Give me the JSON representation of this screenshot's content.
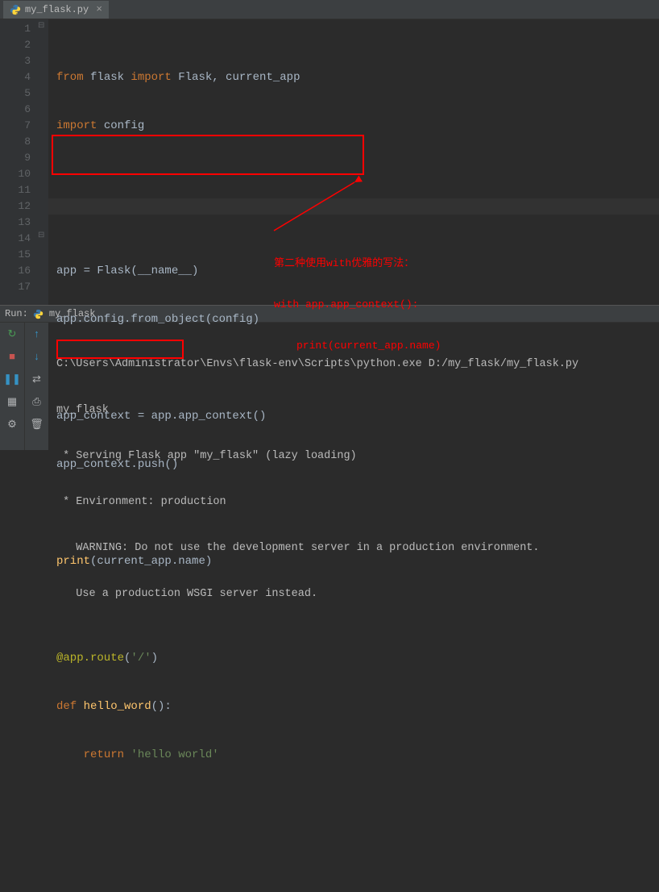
{
  "tab": {
    "filename": "my_flask.py"
  },
  "gutter": [
    "1",
    "2",
    "3",
    "4",
    "5",
    "6",
    "7",
    "8",
    "9",
    "10",
    "11",
    "12",
    "13",
    "14",
    "15",
    "16",
    "17"
  ],
  "code": {
    "l1_from": "from",
    "l1_mod": " flask ",
    "l1_import": "import",
    "l1_names": " Flask, current_app",
    "l2_import": "import",
    "l2_mod": " config",
    "l5": "app = Flask(__name__)",
    "l6": "app.config.from_object(config)",
    "l8": "app_context = app.app_context()",
    "l9": "app_context.push()",
    "l11_print": "print",
    "l11_rest": "(current_app.name)",
    "l13_deco": "@app.route",
    "l13_arg": "(",
    "l13_str": "'/'",
    "l13_close": ")",
    "l14_def": "def ",
    "l14_name": "hello_word",
    "l14_rest": "():",
    "l15_kw": "return ",
    "l15_str": "'hello world'"
  },
  "annotation": {
    "line1": "第二种使用with优雅的写法：",
    "line2": "with app.app_context():",
    "line3": "print(current_app.name)"
  },
  "run": {
    "title_prefix": "Run:",
    "config_name": "my_flask",
    "out1": "C:\\Users\\Administrator\\Envs\\flask-env\\Scripts\\python.exe D:/my_flask/my_flask.py",
    "out2": "my_flask",
    "out3": " * Serving Flask app \"my_flask\" (lazy loading)",
    "out4": " * Environment: production",
    "out5": "   WARNING: Do not use the development server in a production environment.",
    "out6": "   Use a production WSGI server instead."
  },
  "icons": {
    "rerun": "↻",
    "stop": "■",
    "pause": "❚❚",
    "up": "↑",
    "down": "↓",
    "wrap": "⇄",
    "print": "⎙",
    "layout": "▦",
    "settings": "⚙",
    "trash": "🗑"
  }
}
